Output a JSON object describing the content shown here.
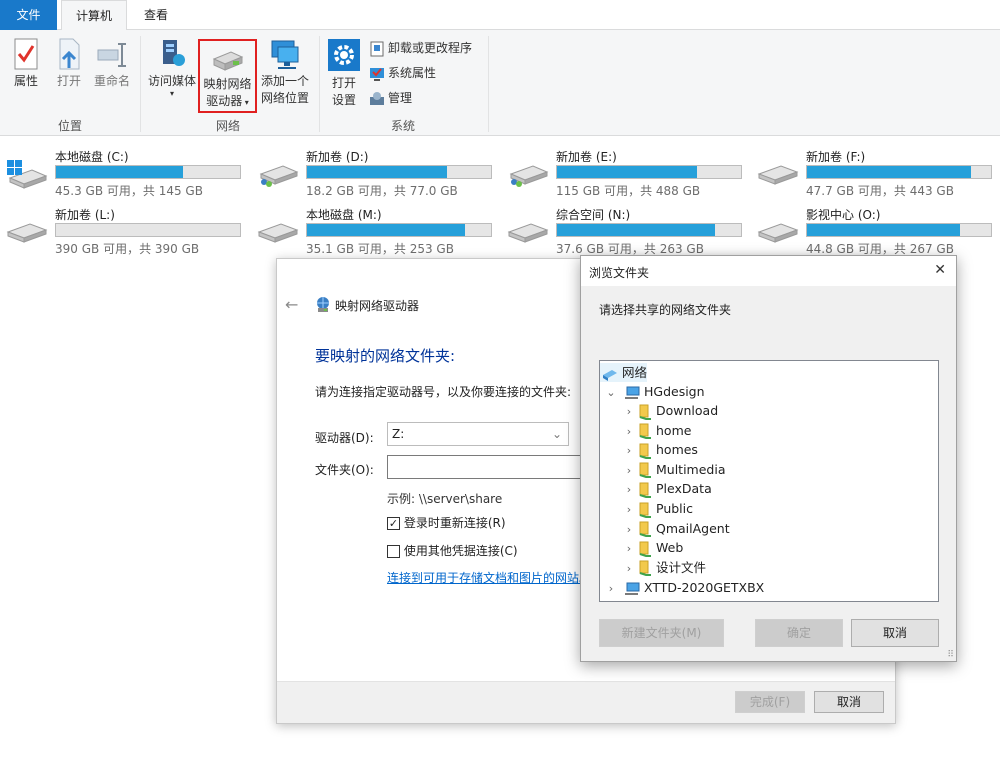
{
  "ribbon": {
    "tabs": [
      "文件",
      "计算机",
      "查看"
    ],
    "location_group": {
      "label": "位置",
      "buttons": [
        "属性",
        "打开",
        "重命名"
      ]
    },
    "network_group": {
      "label": "网络",
      "access_media": "访问媒体",
      "map_drive_line1": "映射网络",
      "map_drive_line2": "驱动器",
      "add_location_line1": "添加一个",
      "add_location_line2": "网络位置"
    },
    "system_group": {
      "label": "系统",
      "open_settings_line1": "打开",
      "open_settings_line2": "设置",
      "uninstall": "卸载或更改程序",
      "system_properties": "系统属性",
      "manage": "管理"
    }
  },
  "drives": [
    {
      "name": "本地磁盘 (C:)",
      "free": "45.3 GB 可用，共 145 GB",
      "used_fraction": 0.69,
      "icon": "windows-drive-icon"
    },
    {
      "name": "新加卷 (D:)",
      "free": "18.2 GB 可用，共 77.0 GB",
      "used_fraction": 0.76,
      "icon": "shared-drive-icon"
    },
    {
      "name": "新加卷 (E:)",
      "free": "115 GB 可用，共 488 GB",
      "used_fraction": 0.76,
      "icon": "shared-drive-icon"
    },
    {
      "name": "新加卷 (F:)",
      "free": "47.7 GB 可用，共 443 GB",
      "used_fraction": 0.89,
      "icon": "drive-icon"
    },
    {
      "name": "新加卷 (L:)",
      "free": "390 GB 可用，共 390 GB",
      "used_fraction": 0.0,
      "icon": "drive-icon"
    },
    {
      "name": "本地磁盘 (M:)",
      "free": "35.1 GB 可用，共 253 GB",
      "used_fraction": 0.86,
      "icon": "drive-icon"
    },
    {
      "name": "综合空间 (N:)",
      "free": "37.6 GB 可用，共 263 GB",
      "used_fraction": 0.86,
      "icon": "drive-icon"
    },
    {
      "name": "影视中心 (O:)",
      "free": "44.8 GB 可用，共 267 GB",
      "used_fraction": 0.83,
      "icon": "drive-icon"
    }
  ],
  "map_dialog": {
    "title": "映射网络驱动器",
    "heading": "要映射的网络文件夹:",
    "instruction": "请为连接指定驱动器号，以及你要连接的文件夹:",
    "drive_label": "驱动器(D):",
    "drive_value": "Z:",
    "folder_label": "文件夹(O):",
    "folder_value": "",
    "example": "示例: \\\\server\\share",
    "reconnect_label": "登录时重新连接(R)",
    "reconnect_checked": true,
    "other_credentials_label": "使用其他凭据连接(C)",
    "other_credentials_checked": false,
    "link": "连接到可用于存储文档和图片的网站。",
    "finish_button": "完成(F)",
    "cancel_button": "取消"
  },
  "browse_dialog": {
    "title": "浏览文件夹",
    "close": "✕",
    "prompt": "请选择共享的网络文件夹",
    "tree": {
      "root": "网络",
      "host": "HGdesign",
      "folders": [
        "Download",
        "home",
        "homes",
        "Multimedia",
        "PlexData",
        "Public",
        "QmailAgent",
        "Web",
        "设计文件"
      ],
      "other_host": "XTTD-2020GETXBX"
    },
    "new_folder_button": "新建文件夹(M)",
    "ok_button": "确定",
    "cancel_button": "取消"
  },
  "colors": {
    "accent": "#1979ca",
    "bar_fill": "#26a0da",
    "link": "#0066cc",
    "heading": "#003399"
  }
}
